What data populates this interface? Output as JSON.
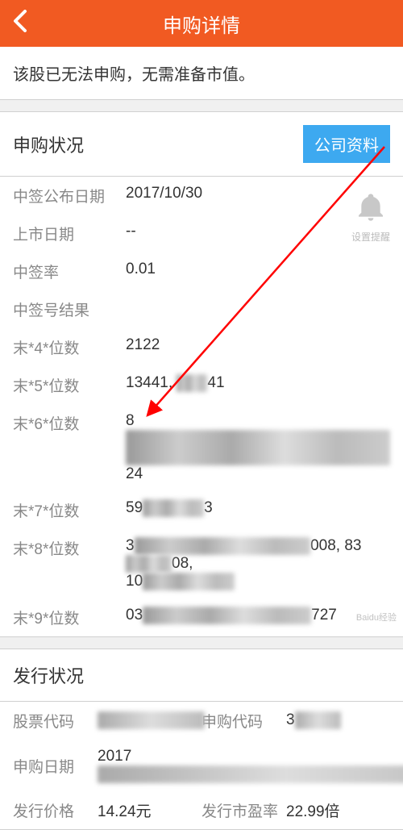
{
  "header": {
    "title": "申购详情"
  },
  "notice": "该股已无法申购，无需准备市值。",
  "subscription": {
    "title": "申购状况",
    "companyBtn": "公司资料",
    "reminder": "设置提醒",
    "rows": {
      "announceDate": {
        "label": "中签公布日期",
        "value": "2017/10/30"
      },
      "listingDate": {
        "label": "上市日期",
        "value": "--"
      },
      "hitRate": {
        "label": "中签率",
        "value": "0.01"
      },
      "result": {
        "label": "中签号结果",
        "value": ""
      },
      "last4": {
        "label": "末*4*位数",
        "value": "2122"
      },
      "last5": {
        "label": "末*5*位数",
        "prefix": "13441, ",
        "suffix": "41"
      },
      "last6": {
        "label": "末*6*位数",
        "prefix": "8",
        "suffix": "24"
      },
      "last7": {
        "label": "末*7*位数",
        "prefix": "59",
        "suffix": "3"
      },
      "last8": {
        "label": "末*8*位数",
        "prefix": "3",
        "mid": "008, 83",
        "suffix": "08,",
        "extra": "10"
      },
      "last9": {
        "label": "末*9*位数",
        "prefix": "03",
        "suffix": "727"
      }
    }
  },
  "issue": {
    "title": "发行状况",
    "stockCode": {
      "label": "股票代码",
      "value": ""
    },
    "subCode": {
      "label": "申购代码",
      "value": "3"
    },
    "subDate": {
      "label": "申购日期",
      "value": "2017"
    },
    "issuePrice": {
      "label": "发行价格",
      "value": "14.24元"
    },
    "peRatio": {
      "label": "发行市盈率",
      "value": "22.99倍"
    }
  }
}
